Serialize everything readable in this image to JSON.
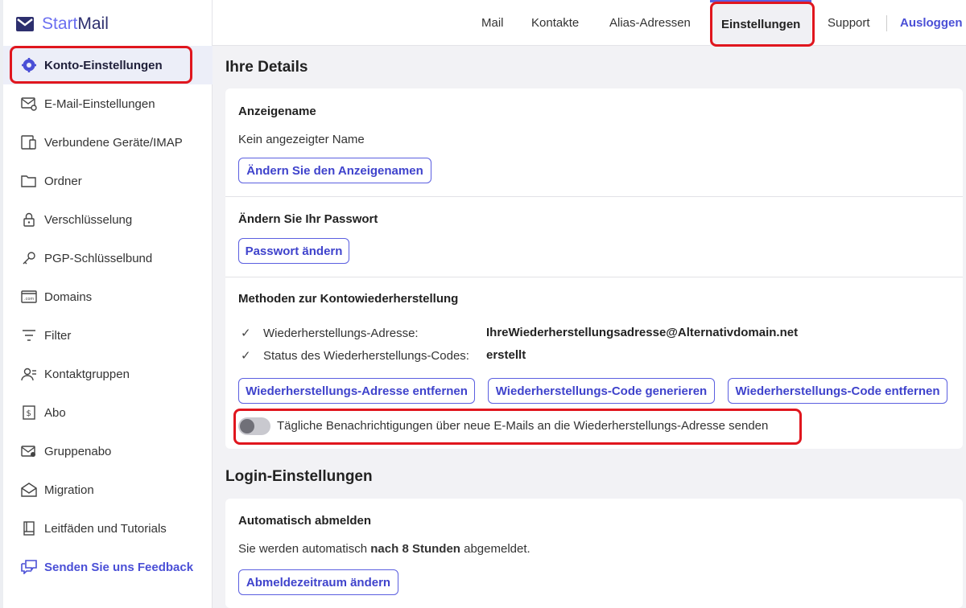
{
  "app": {
    "logo_start": "Start",
    "logo_mail": "Mail"
  },
  "colors": {
    "accent": "#5b5fe0",
    "highlight": "#e0161e",
    "brand_dark": "#2d2f6e"
  },
  "topnav": {
    "mail": "Mail",
    "contacts": "Kontakte",
    "alias": "Alias-Adressen",
    "settings": "Einstellungen",
    "support": "Support",
    "logout": "Ausloggen"
  },
  "sidebar": {
    "items": [
      {
        "label": "Konto-Einstellungen",
        "icon": "gear-icon",
        "active": true
      },
      {
        "label": "E-Mail-Einstellungen",
        "icon": "mail-settings-icon"
      },
      {
        "label": "Verbundene Geräte/IMAP",
        "icon": "devices-icon"
      },
      {
        "label": "Ordner",
        "icon": "folder-icon"
      },
      {
        "label": "Verschlüsselung",
        "icon": "lock-icon"
      },
      {
        "label": "PGP-Schlüsselbund",
        "icon": "key-icon"
      },
      {
        "label": "Domains",
        "icon": "domain-icon"
      },
      {
        "label": "Filter",
        "icon": "filter-icon"
      },
      {
        "label": "Kontaktgruppen",
        "icon": "contact-groups-icon"
      },
      {
        "label": "Abo",
        "icon": "subscription-icon"
      },
      {
        "label": "Gruppenabo",
        "icon": "group-subscription-icon"
      },
      {
        "label": "Migration",
        "icon": "migration-icon"
      },
      {
        "label": "Leitfäden und Tutorials",
        "icon": "book-icon"
      },
      {
        "label": "Senden Sie uns Feedback",
        "icon": "feedback-icon"
      }
    ]
  },
  "details": {
    "title": "Ihre Details",
    "display_name": {
      "label": "Anzeigename",
      "value": "Kein angezeigter Name",
      "button": "Ändern Sie den Anzeigenamen"
    },
    "password": {
      "label": "Ändern Sie Ihr Passwort",
      "button": "Passwort ändern"
    },
    "recovery": {
      "label": "Methoden zur Kontowiederherstellung",
      "address_label": "Wiederherstellungs-Adresse:",
      "address_value": "IhreWiederherstellungsadresse@Alternativdomain.net",
      "code_label": "Status des Wiederherstellungs-Codes:",
      "code_value": "erstellt",
      "btn_remove_address": "Wiederherstellungs-Adresse entfernen",
      "btn_generate_code": "Wiederherstellungs-Code generieren",
      "btn_remove_code": "Wiederherstellungs-Code entfernen",
      "toggle_label": "Tägliche Benachrichtigungen über neue E-Mails an die Wiederherstellungs-Adresse senden",
      "toggle_on": false
    }
  },
  "login": {
    "title": "Login-Einstellungen",
    "auto_logout": {
      "label": "Automatisch abmelden",
      "text_before": "Sie werden automatisch ",
      "text_bold": "nach 8 Stunden",
      "text_after": " abgemeldet.",
      "button": "Abmeldezeitraum ändern"
    }
  }
}
